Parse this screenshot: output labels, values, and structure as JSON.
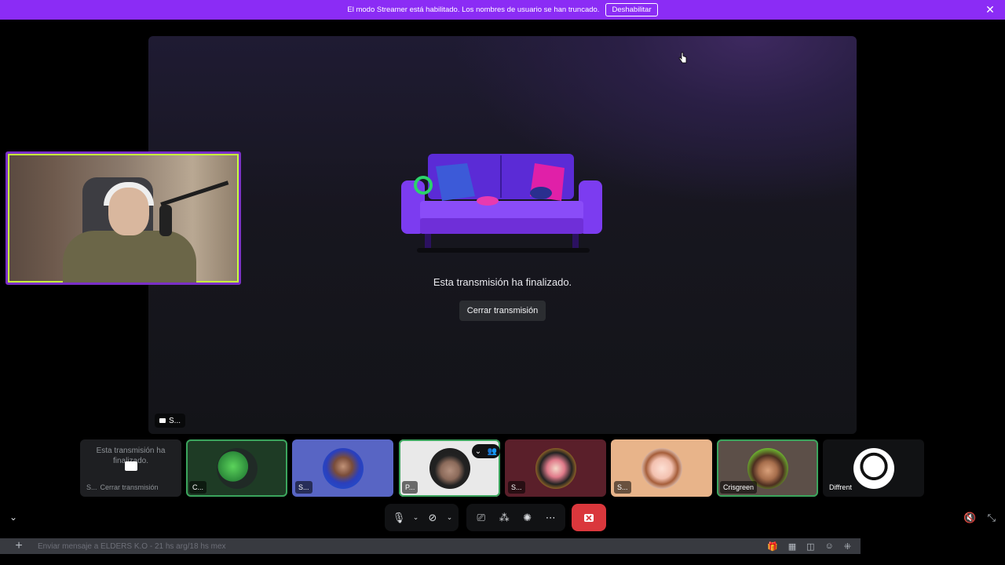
{
  "banner": {
    "message": "El modo Streamer está habilitado. Los nombres de usuario se han truncado.",
    "disable_label": "Deshabilitar",
    "close_icon": "close-icon"
  },
  "stage": {
    "ended_text": "Esta transmisión ha finalizado.",
    "close_stream_label": "Cerrar transmisión",
    "tag_label": "S..."
  },
  "tiles": [
    {
      "label": "S...",
      "ended_text": "Esta transmisión ha finalizado.",
      "close_text": "Cerrar transmisión",
      "kind": "stream"
    },
    {
      "label": "C...",
      "kind": "avatar",
      "color": "#1e3b25",
      "speaking": true
    },
    {
      "label": "S...",
      "kind": "avatar",
      "color": "#5865c4"
    },
    {
      "label": "P...",
      "kind": "avatar",
      "color": "#e9e9e9",
      "speaking": true
    },
    {
      "label": "S...",
      "kind": "avatar",
      "color": "#5a1f2a"
    },
    {
      "label": "S...",
      "kind": "avatar",
      "color": "#e8b48a"
    },
    {
      "label": "Crisgreen",
      "kind": "avatar",
      "color": "#5c4f48",
      "speaking": true
    },
    {
      "label": "Diffrent",
      "kind": "avatar",
      "color": "#111214"
    }
  ],
  "chat": {
    "placeholder": "Enviar mensaje a ELDERS K.O - 21 hs arg/18 hs mex"
  },
  "colors": {
    "banner": "#8b2cf5",
    "end_call": "#da373c",
    "speaking": "#3ba55d"
  }
}
